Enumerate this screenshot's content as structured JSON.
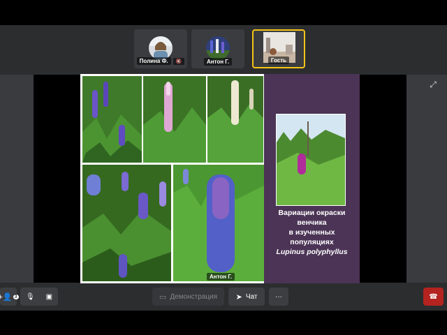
{
  "participants": [
    {
      "name": "Полина Ф.",
      "muted": true
    },
    {
      "name": "Антон Г.",
      "muted": false
    },
    {
      "name": "Гость",
      "muted": false
    }
  ],
  "slide": {
    "caption_lines": [
      "Вариации окраски",
      "венчика",
      "в изученных",
      "популяциях"
    ],
    "caption_latin": "Lupinus polyphyllus",
    "speaker_label": "Антон Г."
  },
  "toolbar": {
    "add_people_badge": "3",
    "demo_label": "Демонстрация",
    "chat_label": "Чат",
    "more_label": "···"
  },
  "icons": [
    "add-person-icon",
    "mic-off-icon",
    "camera-off-icon",
    "screen-share-icon",
    "send-icon",
    "more-icon",
    "hangup-icon",
    "expand-icon"
  ],
  "colors": {
    "active_tile_border": "#f5c518",
    "hangup": "#b4231f",
    "slide_panel": "#4b3456"
  }
}
